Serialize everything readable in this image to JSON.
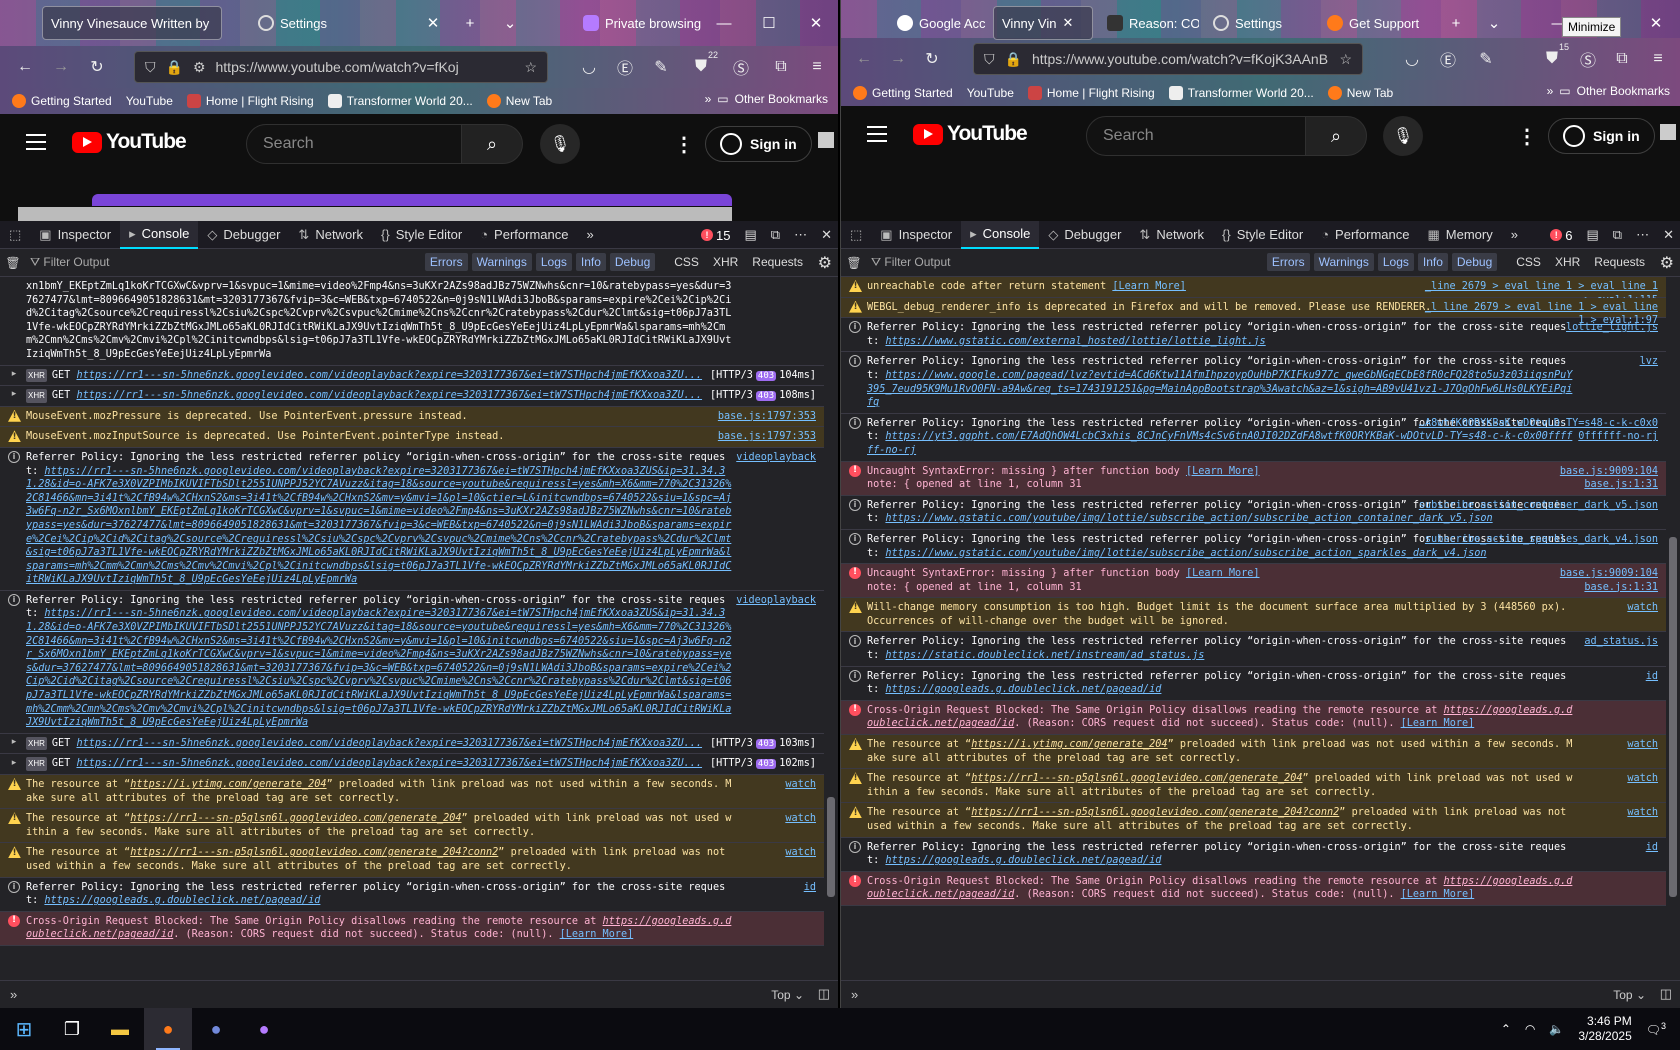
{
  "tooltip": "Minimize",
  "left": {
    "tabs": [
      {
        "label": "Vinny Vinesauce Written by",
        "fav": "yt"
      },
      {
        "label": "Settings",
        "fav": "gear"
      }
    ],
    "private_label": "Private browsing",
    "url": "https://www.youtube.com/watch?v=fKoj",
    "badge": "22",
    "devtools_err": "15"
  },
  "right": {
    "tabs": [
      {
        "label": "Google Acc",
        "fav": "g"
      },
      {
        "label": "Vinny Vin",
        "fav": "yt"
      },
      {
        "label": "Reason: CO",
        "fav": "m"
      },
      {
        "label": "Settings",
        "fav": "gear"
      },
      {
        "label": "Get Support",
        "fav": "ff"
      }
    ],
    "url": "https://www.youtube.com/watch?v=fKojK3AAnBU",
    "badge": "15",
    "devtools_err": "6"
  },
  "bookmarks": [
    {
      "label": "Getting Started",
      "fav": "ff"
    },
    {
      "label": "YouTube",
      "fav": "yt"
    },
    {
      "label": "Home | Flight Rising",
      "fav": "fr"
    },
    {
      "label": "Transformer World 20...",
      "fav": "doc"
    },
    {
      "label": "New Tab",
      "fav": "ff"
    }
  ],
  "other_bookmarks": "Other Bookmarks",
  "youtube": {
    "logo": "YouTube",
    "search_placeholder": "Search",
    "sign_in": "Sign in"
  },
  "devtools": {
    "tabs_left": [
      "Inspector",
      "Console",
      "Debugger",
      "Network",
      "Style Editor",
      "Performance"
    ],
    "tabs_right": [
      "Inspector",
      "Console",
      "Debugger",
      "Network",
      "Style Editor",
      "Performance",
      "Memory"
    ],
    "filter_placeholder": "Filter Output",
    "levels": [
      "Errors",
      "Warnings",
      "Logs",
      "Info",
      "Debug"
    ],
    "types": [
      "CSS",
      "XHR",
      "Requests"
    ],
    "top_label": "Top"
  },
  "logs_left": [
    {
      "t": "info",
      "text": "xn1bmY_EKEptZmLq1koKrTCGXwC&vprv=1&svpuc=1&mime=video%2Fmp4&ns=3uKXr2AZs98adJBz75WZNwhs&cnr=10&ratebypass=yes&dur=37627477&lmt=8096649051828631&mt=3203177367&fvip=3&c=WEB&txp=6740522&n=0j9sN1LWAdi3JboB&sparams=expire%2Cei%2Cip%2Cid%2Citag%2Csource%2Crequiressl%2Csiu%2Cspc%2Cvprv%2Csvpuc%2Cmime%2Cns%2Ccnr%2Cratebypass%2Cdur%2Clmt&sig=t06pJ7a3TL1Vfe-wkEOCpZRYRdYMrkiZZbZtMGxJMLo65aKL0RJIdCitRWiKLaJX9UvtIziqWmTh5t_8_U9pEcGesYeEejUiz4LpLyEpmrWa&lsparams=mh%2Cmm%2Cmn%2Cms%2Cmv%2Cmvi%2Cpl%2Cinitcwndbps&lsig=t06pJ7a3TL1Vfe-wkEOCpZRYRdYMrkiZZbZtMGxJMLo65aKL0RJIdCitRWiKLaJX9UvtIziqWmTh5t_8_U9pEcGesYeEejUiz4LpLyEpmrWa",
      "src": "",
      "noicon": true
    },
    {
      "t": "xhr",
      "text": "https://rr1---sn-5hne6nzk.googlevideo.com/videoplayback?expire=3203177367&ei=tW7STHpch4jmEfKXxoa3ZU...",
      "stat": "[HTTP/3",
      "code": "403",
      "ms": "104ms]"
    },
    {
      "t": "xhr",
      "text": "https://rr1---sn-5hne6nzk.googlevideo.com/videoplayback?expire=3203177367&ei=tW7STHpch4jmEfKXxoa3ZU...",
      "stat": "[HTTP/3",
      "code": "403",
      "ms": "108ms]"
    },
    {
      "t": "warn",
      "text": "MouseEvent.mozPressure is deprecated. Use PointerEvent.pressure instead.",
      "src": "base.js:1797:353"
    },
    {
      "t": "warn",
      "text": "MouseEvent.mozInputSource is deprecated. Use PointerEvent.pointerType instead.",
      "src": "base.js:1797:353"
    },
    {
      "t": "info",
      "text": "Referrer Policy: Ignoring the less restricted referrer policy “origin-when-cross-origin” for the cross-site request: ",
      "url": "https://rr1---sn-5hne6nzk.googlevideo.com/videoplayback?expire=3203177367&ei=tW7STHpch4jmEfKXxoa3ZUS&ip=31.34.31.28&id=o-AFK7e3X0VZPIMbIKUVIFTbSDlt2551UNPPJ52YC7AVuzz&itag=18&source=youtube&requiressl=yes&mh=X6&mm=770%2C31326%2C81466&mn=3i41t%2CfB94w%2CHxnS2&ms=3i41t%2CfB94w%2CHxnS2&mv=y&mvi=1&pl=10&ctier=L&initcwndbps=6740522&siu=1&spc=Aj3w6Fq-n2r_Sx6MOxnlbmY_EKEptZmLq1koKrTCGXwC&vprv=1&svpuc=1&mime=video%2Fmp4&ns=3uKXr2AZs98adJBz75WZNwhs&cnr=10&ratebypass=yes&dur=37627477&lmt=8096649051828631&mt=3203177367&fvip=3&c=WEB&txp=6740522&n=0j9sN1LWAdi3JboB&sparams=expire%2Cei%2Cip%2Cid%2Citag%2Csource%2Crequiressl%2Csiu%2Cspc%2Cvprv%2Csvpuc%2Cmime%2Cns%2Ccnr%2Cratebypass%2Cdur%2Clmt&sig=t06pJ7a3TL1Vfe-wkEOCpZRYRdYMrkiZZbZtMGxJMLo65aKL0RJIdCitRWiKLaJX9UvtIziqWmTh5t_8_U9pEcGesYeEejUiz4LpLyEpmrWa&lsparams=mh%2Cmm%2Cmn%2Cms%2Cmv%2Cmvi%2Cpl%2Cinitcwndbps&lsig=t06pJ7a3TL1Vfe-wkEOCpZRYRdYMrkiZZbZtMGxJMLo65aKL0RJIdCitRWiKLaJX9UvtIziqWmTh5t_8_U9pEcGesYeEejUiz4LpLyEpmrWa",
      "src": "videoplayback"
    },
    {
      "t": "info",
      "text": "Referrer Policy: Ignoring the less restricted referrer policy “origin-when-cross-origin” for the cross-site request: ",
      "url": "https://rr1---sn-5hne6nzk.googlevideo.com/videoplayback?expire=3203177367&ei=tW7STHpch4jmEfKXxoa3ZUS&ip=31.34.31.28&id=o-AFK7e3X0VZPIMbIKUVIFTbSDlt2551UNPPJ52YC7AVuzz&itag=18&source=youtube&requiressl=yes&mh=X6&mm=770%2C31326%2C81466&mn=3i41t%2CfB94w%2CHxnS2&ms=3i41t%2CfB94w%2CHxnS2&mv=y&mvi=1&pl=10&initcwndbps=6740522&siu=1&spc=Aj3w6Fq-n2r_Sx6MOxn1bmY_EKEptZmLq1koKrTCGXwC&vprv=1&svpuc=1&mime=video%2Fmp4&ns=3uKXr2AZs98adJBz75WZNwhs&cnr=10&ratebypass=yes&dur=37627477&lmt=8096649051828631&mt=3203177367&fvip=3&c=WEB&txp=6740522&n=0j9sN1LWAdi3JboB&sparams=expire%2Cei%2Cip%2Cid%2Citag%2Csource%2Crequiressl%2Csiu%2Cspc%2Cvprv%2Csvpuc%2Cmime%2Cns%2Ccnr%2Cratebypass%2Cdur%2Clmt&sig=t06pJ7a3TL1Vfe-wkEOCpZRYRdYMrkiZZbZtMGxJMLo65aKL0RJIdCitRWiKLaJX9UvtIziqWmTh5t_8_U9pEcGesYeEejUiz4LpLyEpmrWa&lsparams=mh%2Cmm%2Cmn%2Cms%2Cmv%2Cmvi%2Cpl%2Cinitcwndbps&lsig=t06pJ7a3TL1Vfe-wkEOCpZRYRdYMrkiZZbZtMGxJMLo65aKL0RJIdCitRWiKLaJX9UvtIziqWmTh5t_8_U9pEcGesYeEejUiz4LpLyEpmrWa",
      "src": "videoplayback"
    },
    {
      "t": "xhr",
      "text": "https://rr1---sn-5hne6nzk.googlevideo.com/videoplayback?expire=3203177367&ei=tW7STHpch4jmEfKXxoa3ZU...",
      "stat": "[HTTP/3",
      "code": "403",
      "ms": "103ms]"
    },
    {
      "t": "xhr",
      "text": "https://rr1---sn-5hne6nzk.googlevideo.com/videoplayback?expire=3203177367&ei=tW7STHpch4jmEfKXxoa3ZU...",
      "stat": "[HTTP/3",
      "code": "403",
      "ms": "102ms]"
    },
    {
      "t": "warn",
      "pre": "The resource at “",
      "url": "https://i.ytimg.com/generate_204",
      "text": "” preloaded with link preload was not used within a few seconds. Make sure all attributes of the preload tag are set correctly.",
      "src": "watch"
    },
    {
      "t": "warn",
      "pre": "The resource at “",
      "url": "https://rr1---sn-p5qlsn6l.googlevideo.com/generate_204",
      "text": "” preloaded with link preload was not used within a few seconds. Make sure all attributes of the preload tag are set correctly.",
      "src": "watch"
    },
    {
      "t": "warn",
      "pre": "The resource at “",
      "url": "https://rr1---sn-p5qlsn6l.googlevideo.com/generate_204?conn2",
      "text": "” preloaded with link preload was not used within a few seconds. Make sure all attributes of the preload tag are set correctly.",
      "src": "watch"
    },
    {
      "t": "info",
      "text": "Referrer Policy: Ignoring the less restricted referrer policy “origin-when-cross-origin” for the cross-site request: ",
      "url": "https://googleads.g.doubleclick.net/pagead/id",
      "src": "id"
    },
    {
      "t": "err",
      "text": "Cross-Origin Request Blocked: The Same Origin Policy disallows reading the remote resource at ",
      "url": "https://googleads.g.doubleclick.net/pagead/id",
      "post": ". (Reason: CORS request did not succeed). Status code: (null).",
      "lm": "[Learn More]",
      "src": ""
    }
  ],
  "logs_right": [
    {
      "t": "warn",
      "text": "unreachable code after return statement ",
      "lm": "[Learn More]",
      "src": "_line 2679 > eval line 1 > eval line 1 > eval:1:115"
    },
    {
      "t": "warn",
      "text": "WEBGL_debug_renderer_info is deprecated in Firefox and will be removed. Please use RENDERER.",
      "src": "_l line 2679 > eval line 1 > eval line 1 > eval:1:97"
    },
    {
      "t": "info",
      "text": "Referrer Policy: Ignoring the less restricted referrer policy “origin-when-cross-origin” for the cross-site request: ",
      "url": "https://www.gstatic.com/external_hosted/lottie/lottie_light.js",
      "src": "lottie_light.js"
    },
    {
      "t": "info",
      "text": "Referrer Policy: Ignoring the less restricted referrer policy “origin-when-cross-origin” for the cross-site request: ",
      "url": "https://www.google.com/pagead/lvz?evtid=ACd6Ktw11AfmIhpzoypOuHbP7KIFku977c_qweGbNGqECbE8fR0cFQ28to5u3z03iiqsnPuY395_7eud95K9Mu1RvO0FN-a9Aw&req_ts=1743191251&pg=MainAppBootstrap%3Awatch&az=1&sigh=AB9vU41vz1-J7OqOhFw6LHs0LKYEiPqifq",
      "src": "lvz"
    },
    {
      "t": "info",
      "text": "Referrer Policy: Ignoring the less restricted referrer policy “origin-when-cross-origin” for the cross-site request: ",
      "url": "https://yt3.ggpht.com/E7AdQhOW4LcbC3xhis_8CJnCyFnVMs4cSv6tnA0JI02DZdFA8wtfK0ORYKBaK-wDOtvLD-TY=s48-c-k-c0x00ffffff-no-rj",
      "src": "…A8wtfK0ORYKBaK-wDOtvLD-TY=s48-c-k-c0x00ffffff-no-rj"
    },
    {
      "t": "err",
      "text": "Uncaught SyntaxError: missing } after function body ",
      "lm": "[Learn More]",
      "post2": "note: { opened at line 1, column 31",
      "src": "base.js:9009:104\nbase.js:1:31"
    },
    {
      "t": "info",
      "text": "Referrer Policy: Ignoring the less restricted referrer policy “origin-when-cross-origin” for the cross-site request: ",
      "url": "https://www.gstatic.com/youtube/img/lottie/subscribe_action/subscribe_action_container_dark_v5.json",
      "src": "subscribe_action_container_dark_v5.json"
    },
    {
      "t": "info",
      "text": "Referrer Policy: Ignoring the less restricted referrer policy “origin-when-cross-origin” for the cross-site request: ",
      "url": "https://www.gstatic.com/youtube/img/lottie/subscribe_action/subscribe_action_sparkles_dark_v4.json",
      "src": "subscribe_action_sparkles_dark_v4.json"
    },
    {
      "t": "err",
      "text": "Uncaught SyntaxError: missing } after function body ",
      "lm": "[Learn More]",
      "post2": "note: { opened at line 1, column 31",
      "src": "base.js:9009:104\nbase.js:1:31"
    },
    {
      "t": "warn",
      "text": "Will-change memory consumption is too high. Budget limit is the document surface area multiplied by 3 (448560 px). Occurrences of will-change over the budget will be ignored.",
      "src": "watch"
    },
    {
      "t": "info",
      "text": "Referrer Policy: Ignoring the less restricted referrer policy “origin-when-cross-origin” for the cross-site request: ",
      "url": "https://static.doubleclick.net/instream/ad_status.js",
      "src": "ad_status.js"
    },
    {
      "t": "info",
      "text": "Referrer Policy: Ignoring the less restricted referrer policy “origin-when-cross-origin” for the cross-site request: ",
      "url": "https://googleads.g.doubleclick.net/pagead/id",
      "src": "id"
    },
    {
      "t": "err",
      "text": "Cross-Origin Request Blocked: The Same Origin Policy disallows reading the remote resource at ",
      "url": "https://googleads.g.doubleclick.net/pagead/id",
      "post": ". (Reason: CORS request did not succeed). Status code: (null).",
      "lm": "[Learn More]",
      "src": ""
    },
    {
      "t": "warn",
      "pre": "The resource at “",
      "url": "https://i.ytimg.com/generate_204",
      "text": "” preloaded with link preload was not used within a few seconds. Make sure all attributes of the preload tag are set correctly.",
      "src": "watch"
    },
    {
      "t": "warn",
      "pre": "The resource at “",
      "url": "https://rr1---sn-p5qlsn6l.googlevideo.com/generate_204",
      "text": "” preloaded with link preload was not used within a few seconds. Make sure all attributes of the preload tag are set correctly.",
      "src": "watch"
    },
    {
      "t": "warn",
      "pre": "The resource at “",
      "url": "https://rr1---sn-p5qlsn6l.googlevideo.com/generate_204?conn2",
      "text": "” preloaded with link preload was not used within a few seconds. Make sure all attributes of the preload tag are set correctly.",
      "src": "watch"
    },
    {
      "t": "info",
      "text": "Referrer Policy: Ignoring the less restricted referrer policy “origin-when-cross-origin” for the cross-site request: ",
      "url": "https://googleads.g.doubleclick.net/pagead/id",
      "src": "id"
    },
    {
      "t": "err",
      "text": "Cross-Origin Request Blocked: The Same Origin Policy disallows reading the remote resource at ",
      "url": "https://googleads.g.doubleclick.net/pagead/id",
      "post": ". (Reason: CORS request did not succeed). Status code: (null).",
      "lm": "[Learn More]",
      "src": ""
    }
  ],
  "taskbar": {
    "time": "3:46 PM",
    "date": "3/28/2025",
    "notif": "3"
  }
}
